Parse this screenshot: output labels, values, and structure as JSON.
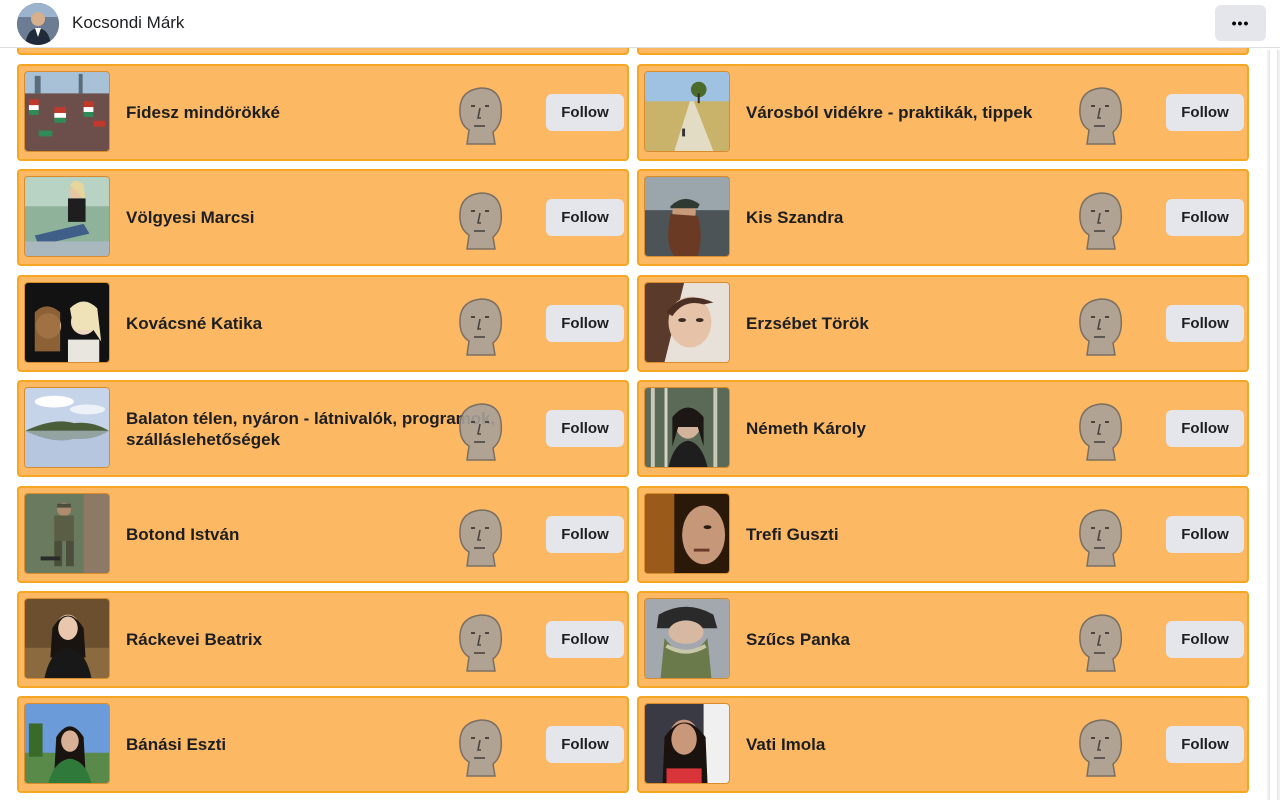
{
  "header": {
    "profile_name": "Kocsondi Márk",
    "more_label": "•••"
  },
  "cards": [
    {
      "title": "Fidesz mindörökké",
      "follow_label": "Follow",
      "thumb": "crowd-flags"
    },
    {
      "title": "Városból vidékre - praktikák, tippek",
      "follow_label": "Follow",
      "thumb": "country-road"
    },
    {
      "title": "Völgyesi Marcsi",
      "follow_label": "Follow",
      "thumb": "woman-sitting"
    },
    {
      "title": "Kis Szandra",
      "follow_label": "Follow",
      "thumb": "woman-cap"
    },
    {
      "title": "Kovácsné Katika",
      "follow_label": "Follow",
      "thumb": "two-women"
    },
    {
      "title": "Erzsébet Török",
      "follow_label": "Follow",
      "thumb": "woman-portrait"
    },
    {
      "title": "Balaton télen, nyáron - látnivalók, programok, szálláslehetőségek",
      "follow_label": "Follow",
      "thumb": "lake-landscape"
    },
    {
      "title": "Németh Károly",
      "follow_label": "Follow",
      "thumb": "man-forest"
    },
    {
      "title": "Botond István",
      "follow_label": "Follow",
      "thumb": "soldier"
    },
    {
      "title": "Trefi Guszti",
      "follow_label": "Follow",
      "thumb": "man-dark"
    },
    {
      "title": "Ráckevei Beatrix",
      "follow_label": "Follow",
      "thumb": "woman-dark-hair"
    },
    {
      "title": "Szűcs Panka",
      "follow_label": "Follow",
      "thumb": "woman-mask"
    },
    {
      "title": "Bánási Eszti",
      "follow_label": "Follow",
      "thumb": "woman-outdoor"
    },
    {
      "title": "Vati Imola",
      "follow_label": "Follow",
      "thumb": "woman-selfie"
    }
  ],
  "colors": {
    "card_bg": "#fdb863",
    "card_border": "#f5a623",
    "button_bg": "#e4e6eb"
  },
  "icons": {
    "npc_face": "npc-face-icon",
    "more": "more-dots-icon"
  }
}
